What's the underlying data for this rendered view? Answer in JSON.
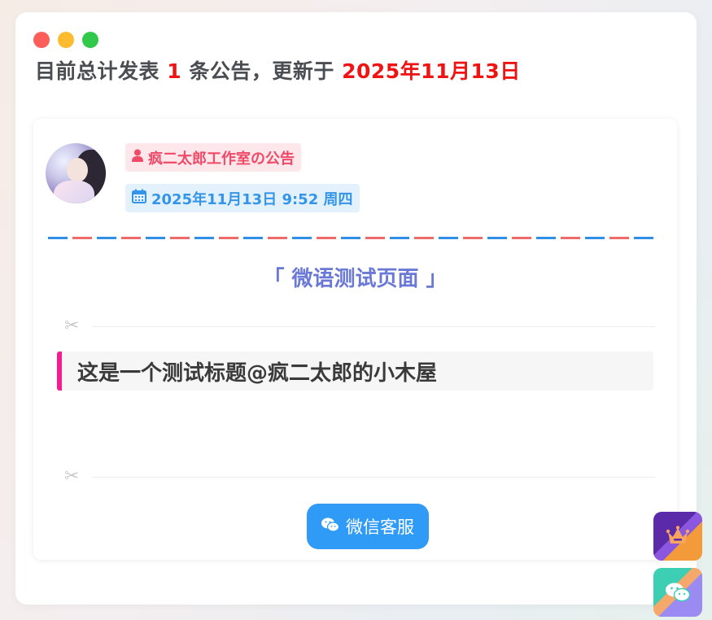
{
  "summary": {
    "prefix": "目前总计发表",
    "count": "1",
    "middle": "条公告，更新于",
    "date": "2025年11月13日"
  },
  "post": {
    "author": "疯二太郎工作室の公告",
    "datetime": "2025年11月13日 9:52 周四",
    "title": "「 微语测试页面 」",
    "heading": "这是一个测试标题@疯二太郎的小木屋",
    "wechat_button": "微信客服"
  },
  "icons": {
    "user": "user-icon",
    "calendar": "calendar-icon",
    "scissors": "scissors-icon",
    "wechat": "wechat-icon",
    "crown": "crown-icon"
  },
  "colors": {
    "highlight": "#ef1414",
    "author_badge": "#ef4a68",
    "date_badge": "#3495e8",
    "title": "#6a78d6",
    "heading_accent": "#f21d8e",
    "button": "#2f9bf7"
  }
}
